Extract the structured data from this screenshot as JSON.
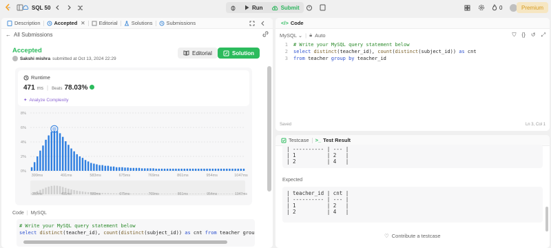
{
  "topbar": {
    "problem_list": "SQL 50",
    "run": "Run",
    "submit": "Submit",
    "streak": "0",
    "premium": "Premium"
  },
  "left": {
    "tabs": {
      "description": "Description",
      "accepted": "Accepted",
      "editorial": "Editorial",
      "solutions": "Solutions",
      "submissions": "Submissions"
    },
    "back_link": "All Submissions",
    "status": "Accepted",
    "user": "Sakshi mishra",
    "submitted_text": "submitted at Oct 13, 2024 22:29",
    "editorial_btn": "Editorial",
    "solution_btn": "Solution",
    "runtime_label": "Runtime",
    "runtime_value": "471",
    "runtime_unit": "ms",
    "beats_label": "Beats",
    "beats_value": "78.03%",
    "analyze": "Analyze Complexity",
    "code_label": "Code",
    "code_lang": "MySQL",
    "code_lines": [
      "# Write your MySQL query statement below",
      "select distinct(teacher_id), count(distinct(subject_id)) as cnt from teacher group"
    ]
  },
  "chart_data": {
    "type": "bar",
    "ylabel": "",
    "yticks": [
      "8%",
      "6%",
      "4%",
      "2%",
      "0%"
    ],
    "ylim": [
      0,
      8
    ],
    "xticks": [
      "399ms",
      "491ms",
      "583ms",
      "675ms",
      "769ms",
      "861ms",
      "954ms",
      "1047ms"
    ],
    "mini_xticks": [
      "399ms",
      "491ms",
      "583ms",
      "675ms",
      "769ms",
      "861ms",
      "954ms",
      "1047ms"
    ],
    "highlight_index": 8,
    "values": [
      0.5,
      1.2,
      2.0,
      2.8,
      3.5,
      4.3,
      4.9,
      5.4,
      5.6,
      5.5,
      5.2,
      4.7,
      4.1,
      3.6,
      3.1,
      2.7,
      2.3,
      2.0,
      1.8,
      1.5,
      1.3,
      1.1,
      1.0,
      0.9,
      0.8,
      0.8,
      0.7,
      0.7,
      0.6,
      0.6,
      0.5,
      0.5,
      0.5,
      0.45,
      0.45,
      0.4,
      0.4,
      0.4,
      0.4,
      0.35,
      0.35,
      0.35,
      0.35,
      0.35,
      0.3,
      0.3,
      0.3,
      0.3,
      0.3,
      0.3,
      0.3,
      0.3,
      0.3,
      0.3,
      0.3,
      0.3,
      0.3,
      0.3,
      0.3,
      0.3,
      0.3,
      0.3,
      0.3,
      0.3,
      0.3,
      0.3,
      0.3,
      0.3,
      0.3,
      0.3,
      0.3,
      0.3,
      0.3,
      0.3,
      0.3,
      0.3
    ]
  },
  "code": {
    "tab": "Code",
    "lang": "MySQL",
    "mode": "Auto",
    "lines": [
      "# Write your MySQL query statement below",
      "select distinct(teacher_id), count(distinct(subject_id)) as cnt",
      "from teacher group by teacher_id"
    ],
    "saved": "Saved",
    "cursor": "Ln 3, Col 1"
  },
  "test": {
    "testcase_tab": "Testcase",
    "result_tab": "Test Result",
    "output_rows": [
      "| ---------- | --- |",
      "| 1          | 2   |",
      "| 2          | 4   |"
    ],
    "expected_label": "Expected",
    "expected_rows": [
      "| teacher_id | cnt |",
      "| ---------- | --- |",
      "| 1          | 2   |",
      "| 2          | 4   |"
    ],
    "contribute": "Contribute a testcase"
  }
}
